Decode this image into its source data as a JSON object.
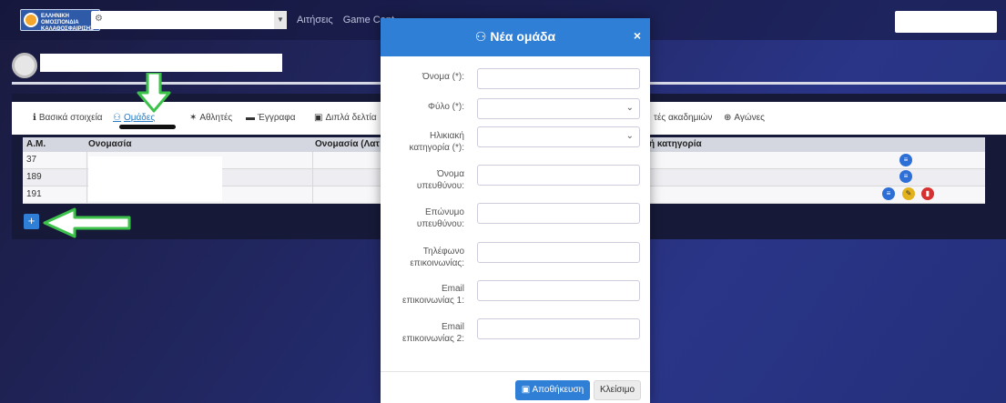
{
  "header": {
    "logo_text": "ΕΛΛΗΝΙΚΗ\nΟΜΟΣΠΟΝΔΙΑ\nΚΑΛΑΘΟΣΦΑΙΡΙΣΗΣ",
    "nav_links": [
      "Αιτήσεις",
      "Game Cent"
    ]
  },
  "tabs": [
    {
      "label": "Βασικά στοιχεία",
      "icon": "info-circle-icon"
    },
    {
      "label": "Ομάδες",
      "icon": "users-icon",
      "active": true
    },
    {
      "label": "Αθλητές",
      "icon": "runner-icon"
    },
    {
      "label": "Έγγραφα",
      "icon": "folder-icon"
    },
    {
      "label": "Διπλά δελτία",
      "icon": "id-card-icon"
    },
    {
      "label": "τές ακαδημιών",
      "icon": ""
    },
    {
      "label": "Αγώνες",
      "icon": "basketball-icon"
    }
  ],
  "table": {
    "headers": [
      "Α.Μ.",
      "Ονομασία",
      "Ονομασία (Λατ",
      "ή κατηγορία"
    ],
    "rows": [
      {
        "am": "37"
      },
      {
        "am": "189"
      },
      {
        "am": "191"
      }
    ]
  },
  "modal": {
    "title": "Νέα ομάδα",
    "close_symbol": "×",
    "fields": [
      {
        "label": "Όνομα (*):",
        "type": "text"
      },
      {
        "label": "Φύλο (*):",
        "type": "select"
      },
      {
        "label": "Ηλικιακή κατηγορία (*):",
        "type": "select"
      },
      {
        "label": "Όνομα υπευθύνου:",
        "type": "text"
      },
      {
        "label": "Επώνυμο υπευθύνου:",
        "type": "text"
      },
      {
        "label": "Τηλέφωνο επικοινωνίας:",
        "type": "text"
      },
      {
        "label": "Email επικοινωνίας 1:",
        "type": "text"
      },
      {
        "label": "Email επικοινωνίας 2:",
        "type": "text"
      }
    ],
    "save_label": "Αποθήκευση",
    "close_label": "Κλείσιμο"
  },
  "colors": {
    "primary": "#2f7fd6",
    "arrow_green": "#3cc24a",
    "background": "#232a6a"
  }
}
